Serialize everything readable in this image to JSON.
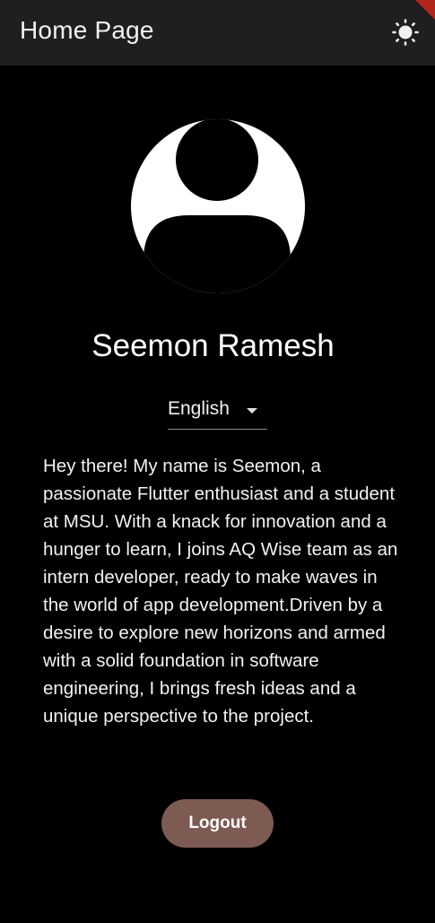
{
  "appbar": {
    "title": "Home Page",
    "theme_icon": "sun-icon"
  },
  "profile": {
    "avatar_icon": "person-icon",
    "name": "Seemon Ramesh",
    "language": {
      "selected": "English",
      "caret_icon": "caret-down-icon"
    },
    "bio": "Hey there! My name is Seemon, a passionate Flutter enthusiast and a student at MSU. With a knack for innovation and a hunger to learn, I joins AQ Wise team as an intern developer, ready to make waves in the world of app development.Driven by a desire to explore new horizons and armed with a solid foundation in software engineering, I brings fresh ideas and a unique perspective to the project."
  },
  "actions": {
    "logout_label": "Logout"
  },
  "colors": {
    "background": "#000000",
    "appbar": "#1f1f22",
    "logout_button": "#7d5a52",
    "debug_banner": "#b3261e"
  }
}
